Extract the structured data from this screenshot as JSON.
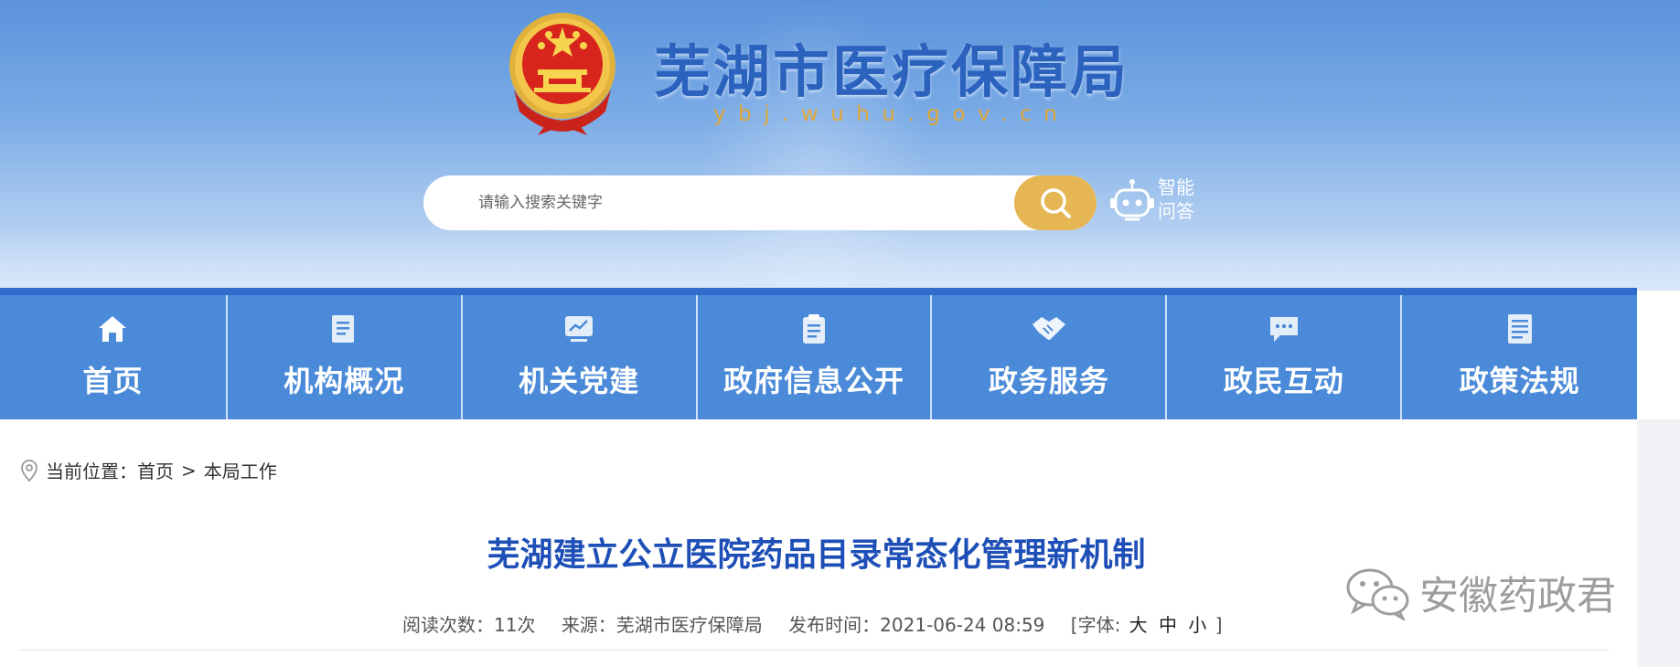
{
  "header": {
    "site_title": "芜湖市医疗保障局",
    "site_domain": "ybj.wuhu.gov.cn",
    "search_placeholder": "请输入搜索关键字",
    "ai_qa_label": "智能问答"
  },
  "nav": {
    "items": [
      {
        "label": "首页",
        "icon": "home-icon"
      },
      {
        "label": "机构概况",
        "icon": "document-icon"
      },
      {
        "label": "机关党建",
        "icon": "chart-screen-icon"
      },
      {
        "label": "政府信息公开",
        "icon": "clipboard-icon"
      },
      {
        "label": "政务服务",
        "icon": "handshake-icon"
      },
      {
        "label": "政民互动",
        "icon": "chat-bubble-icon"
      },
      {
        "label": "政策法规",
        "icon": "stacked-docs-icon"
      }
    ]
  },
  "breadcrumb": {
    "prefix": "当前位置：",
    "home": "首页",
    "separator": ">",
    "current": "本局工作"
  },
  "article": {
    "title": "芜湖建立公立医院药品目录常态化管理新机制",
    "read_count": "阅读次数：11次",
    "source": "来源：芜湖市医疗保障局",
    "publish_time": "发布时间：2021-06-24 08:59",
    "font_size_label": "[字体:",
    "font_large": "大",
    "font_medium": "中",
    "font_small": "小",
    "font_size_close": "]"
  },
  "watermark": {
    "text": "安徽药政君"
  },
  "colors": {
    "banner_top": "#5b93db",
    "nav_bg": "#4a8ad8",
    "title_blue": "#1e4fb7",
    "search_button": "#e6b655",
    "domain_gold": "#e1a738"
  }
}
